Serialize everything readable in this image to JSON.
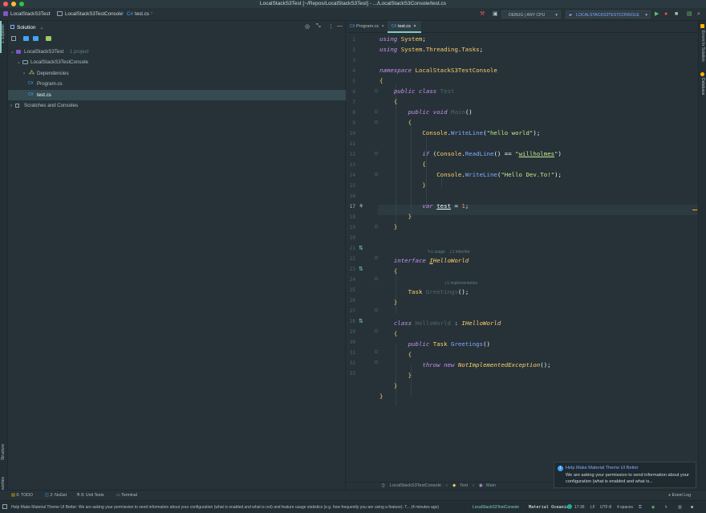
{
  "window": {
    "title": "LocalStackS3Test [~/Repos/LocalStackS3Test] - .../LocalStackS3Console/test.cs",
    "colors": {
      "close": "#ff5f57",
      "minimize": "#febc2e",
      "maximize": "#28c840"
    }
  },
  "navbar": {
    "breadcrumbs": [
      "LocalStackS3Test",
      "LocalStackS3TestConsole",
      "test.cs"
    ],
    "config": "DEBUG | ANY CPU",
    "run_target": "LOCALSTACKS3TESTCONSOLE"
  },
  "left_strip": {
    "explorer": "1: Explorer",
    "structure": "Structure",
    "favorites": "2: Favorites"
  },
  "right_strip": {
    "errors": "Errors In Solution",
    "database": "Database"
  },
  "solution_panel": {
    "title": "Solution",
    "tree": [
      {
        "label": "LocalStackS3Test",
        "suffix": " · 1 project",
        "depth": 0,
        "icon": "solution-icon"
      },
      {
        "label": "LocalStackS3TestConsole",
        "suffix": "",
        "depth": 1,
        "icon": "project-icon"
      },
      {
        "label": "Dependencies",
        "suffix": "",
        "depth": 2,
        "icon": "dependencies-icon"
      },
      {
        "label": "Program.cs",
        "suffix": "",
        "depth": 2,
        "icon": "csharp-file-icon"
      },
      {
        "label": "test.cs",
        "suffix": "",
        "depth": 2,
        "icon": "csharp-file-icon",
        "selected": true
      },
      {
        "label": "Scratches and Consoles",
        "suffix": "",
        "depth": 0,
        "icon": "scratches-icon"
      }
    ]
  },
  "editor": {
    "tabs": [
      {
        "label": "Program.cs",
        "active": false
      },
      {
        "label": "test.cs",
        "active": true
      }
    ],
    "line_numbers": [
      "1",
      "2",
      "3",
      "4",
      "5",
      "6",
      "7",
      "8",
      "9",
      "10",
      "11",
      "12",
      "13",
      "14",
      "15",
      "16",
      "17",
      "18",
      "19",
      "20",
      "21",
      "22",
      "23",
      "24",
      "25",
      "26",
      "27",
      "28",
      "29",
      "30",
      "31",
      "32",
      "33"
    ],
    "hints": {
      "usages": "1 usage",
      "inheritor": "1 inheritor",
      "implementation": "1 implementation"
    },
    "breadcrumbs": [
      "LocalStackS3TestConsole",
      "Test",
      "Main"
    ]
  },
  "bottom_tools": [
    "6: TODO",
    "2: NuGet",
    "8: Unit Tests",
    "Terminal"
  ],
  "event_log": "Event Log",
  "notification": {
    "title": "Help Make Material Theme UI Better",
    "body": "We are asking your permission to send information about your configuration (what is enabled and what is..."
  },
  "status": {
    "message": "Help Make Material Theme UI Better: We are asking your permission to send information about your configuration (what is enabled and what is not) and feature usage statistics (e.g. how frequently you are using a feature). T... (4 minutes ago)",
    "project": "LocalStackS3TestConsole",
    "theme": "Material Oceanic",
    "position": "17:36",
    "line_sep": "LF",
    "encoding": "UTF-8",
    "indent": "4 spaces"
  }
}
